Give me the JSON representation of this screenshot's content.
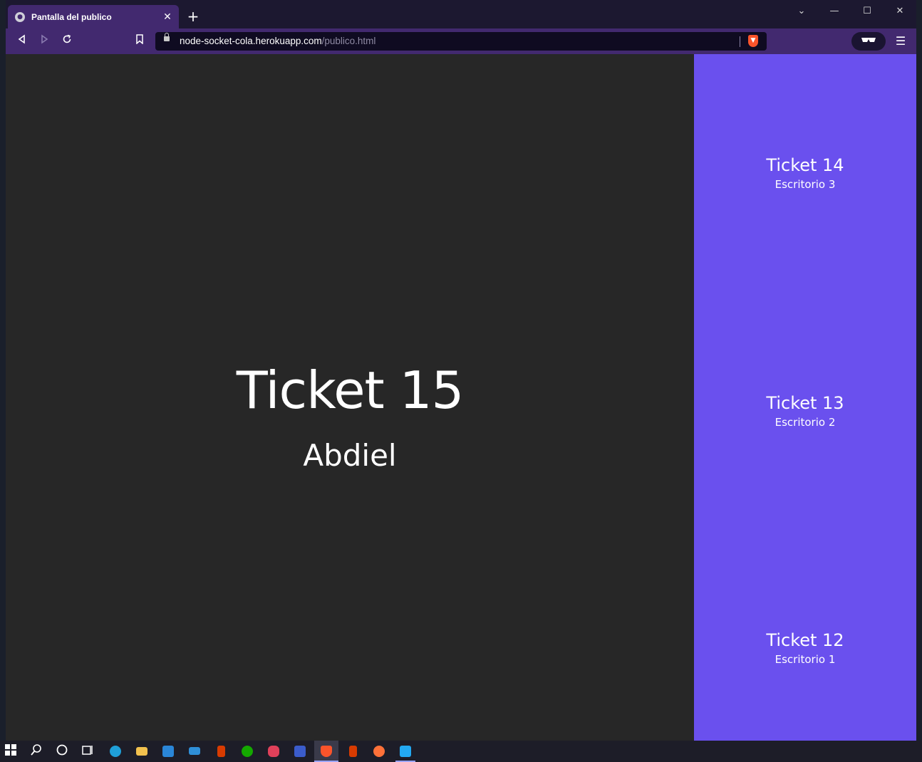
{
  "browser": {
    "tab_title": "Pantalla del publico",
    "tab_close": "✕",
    "new_tab": "+",
    "url_host": "node-socket-cola.herokuapp.com",
    "url_path": "/publico.html"
  },
  "window_controls": {
    "tab_list": "⌄",
    "minimize": "—",
    "maximize": "☐",
    "close": "✕"
  },
  "main": {
    "ticket": "Ticket 15",
    "desk": "Abdiel"
  },
  "sidebar": {
    "items": [
      {
        "ticket": "Ticket 14",
        "desk": "Escritorio 3"
      },
      {
        "ticket": "Ticket 13",
        "desk": "Escritorio 2"
      },
      {
        "ticket": "Ticket 12",
        "desk": "Escritorio 1"
      }
    ]
  },
  "colors": {
    "main_background": "#272727",
    "sidebar_background": "#6a50ee",
    "browser_chrome": "#42296f"
  },
  "taskbar": {
    "icons": [
      "windows-start-icon",
      "search-icon",
      "cortana-icon",
      "task-view-icon",
      "edge-icon",
      "file-explorer-icon",
      "store-icon",
      "mail-icon",
      "office-icon",
      "upwork-icon",
      "webcam-icon",
      "translator-icon",
      "brave-icon",
      "office-icon-2",
      "firefox-icon",
      "vscode-icon"
    ]
  }
}
